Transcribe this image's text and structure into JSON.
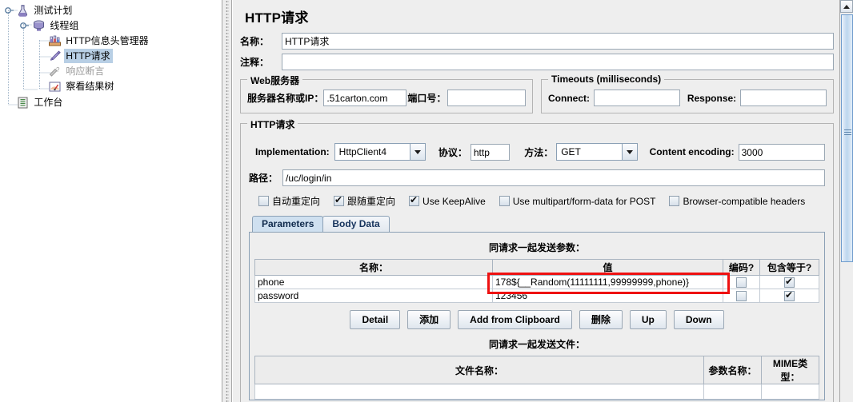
{
  "tree": {
    "nodes": [
      {
        "label": "测试计划",
        "icon": "test-plan-flask-icon",
        "depth": 0,
        "selected": false,
        "disabled": false
      },
      {
        "label": "线程组",
        "icon": "thread-group-icon",
        "depth": 1,
        "selected": false,
        "disabled": false
      },
      {
        "label": "HTTP信息头管理器",
        "icon": "header-manager-icon",
        "depth": 2,
        "selected": false,
        "disabled": false
      },
      {
        "label": "HTTP请求",
        "icon": "http-request-pencil-icon",
        "depth": 2,
        "selected": true,
        "disabled": false
      },
      {
        "label": "响应断言",
        "icon": "assertion-icon",
        "depth": 2,
        "selected": false,
        "disabled": true
      },
      {
        "label": "察看结果树",
        "icon": "view-results-tree-icon",
        "depth": 2,
        "selected": false,
        "disabled": false
      },
      {
        "label": "工作台",
        "icon": "workbench-icon",
        "depth": 0,
        "selected": false,
        "disabled": false
      }
    ]
  },
  "main": {
    "page_title": "HTTP请求",
    "name_label": "名称：",
    "name_value": "HTTP请求",
    "comment_label": "注释：",
    "comment_value": "",
    "web_server": {
      "title": "Web服务器",
      "server_label": "服务器名称或IP：",
      "server_value": ".51carton.com",
      "port_label": "端口号：",
      "port_value": ""
    },
    "timeouts": {
      "title": "Timeouts (milliseconds)",
      "connect_label": "Connect:",
      "connect_value": "",
      "response_label": "Response:",
      "response_value": ""
    },
    "http_request": {
      "title": "HTTP请求",
      "implementation_label": "Implementation:",
      "implementation_value": "HttpClient4",
      "protocol_label": "协议：",
      "protocol_value": "http",
      "method_label": "方法：",
      "method_value": "GET",
      "content_encoding_label": "Content encoding:",
      "content_encoding_value": "3000",
      "path_label": "路径：",
      "path_value": "/uc/login/in",
      "checkboxes": [
        {
          "label": "自动重定向",
          "checked": false
        },
        {
          "label": "跟随重定向",
          "checked": true
        },
        {
          "label": "Use KeepAlive",
          "checked": true
        },
        {
          "label": "Use multipart/form-data for POST",
          "checked": false
        },
        {
          "label": "Browser-compatible headers",
          "checked": false
        }
      ]
    },
    "tabs": [
      {
        "label": "Parameters",
        "active": true
      },
      {
        "label": "Body Data",
        "active": false
      }
    ],
    "params": {
      "section_title": "同请求一起发送参数：",
      "columns": [
        "名称：",
        "值",
        "编码?",
        "包含等于?"
      ],
      "rows": [
        {
          "name": "phone",
          "value": "178${__Random(11111111,99999999,phone)}",
          "encode": false,
          "include_equals": true
        },
        {
          "name": "password",
          "value": "123456",
          "encode": false,
          "include_equals": true
        }
      ],
      "buttons": [
        "Detail",
        "添加",
        "Add from Clipboard",
        "删除",
        "Up",
        "Down"
      ]
    },
    "files": {
      "section_title": "同请求一起发送文件：",
      "columns": [
        "文件名称：",
        "参数名称：",
        "MIME类型："
      ]
    }
  },
  "colors": {
    "selection": "#b8cfe5",
    "annotation": "#ee1111",
    "panel_bg": "#eeeeee",
    "tab_active": "#cfe0f0"
  }
}
